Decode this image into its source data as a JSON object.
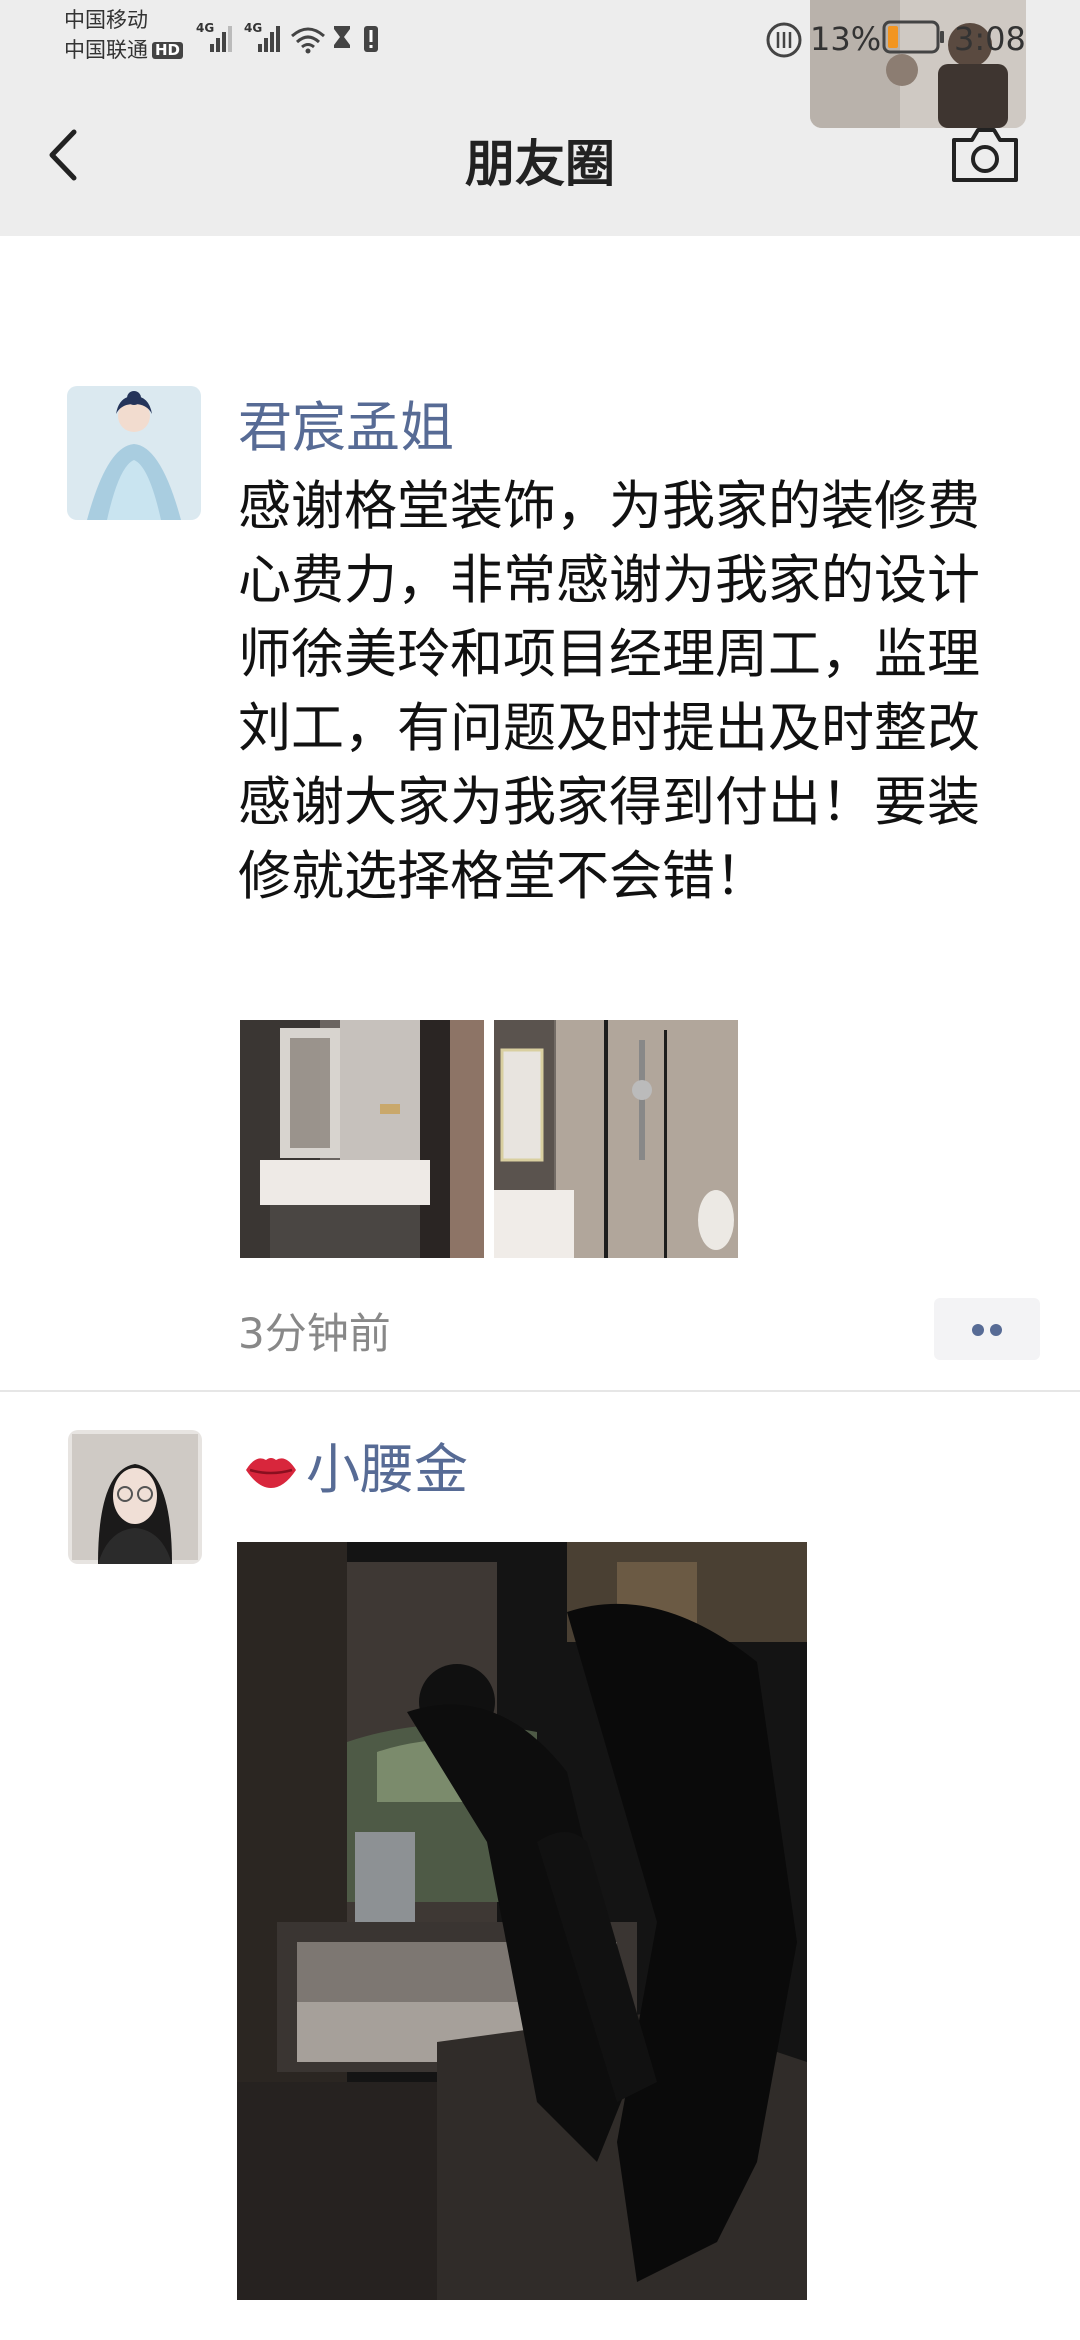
{
  "status_bar": {
    "carrier_1": "中国移动",
    "carrier_2": "中国联通",
    "hd_label": "HD",
    "network_1": "4G",
    "network_2": "4G",
    "battery_percent": "13%",
    "time": "3:08"
  },
  "nav": {
    "title": "朋友圈",
    "back_icon": "chevron-left-icon",
    "camera_icon": "camera-icon"
  },
  "posts": [
    {
      "nickname": "君宸孟姐",
      "text": "感谢格堂装饰，为我家的装修费心费力，非常感谢为我家的设计师徐美玲和项目经理周工，监理刘工，有问题及时提出及时整改感谢大家为我家得到付出！要装修就选择格堂不会错！",
      "time": "3分钟前",
      "image_count": 2
    },
    {
      "nickname": "小腰金",
      "nickname_icon": "lips-icon",
      "media": "video"
    }
  ],
  "colors": {
    "nickname": "#576b95",
    "nav_background": "#ededed",
    "time_text": "#888888"
  }
}
